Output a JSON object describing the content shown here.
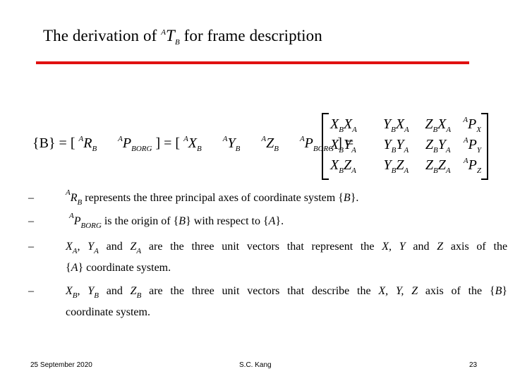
{
  "slide": {
    "title": {
      "prefix": "The derivation of ",
      "sup": "A",
      "symbol": "T",
      "sub": "B",
      "suffix": " for frame description"
    },
    "accent_color": "#e01010",
    "equation": {
      "lhs": "{B} = [",
      "r_sup": "A",
      "r_sym": "R",
      "r_sub": "B",
      "p_sup": "A",
      "p_sym": "P",
      "p_sub": "BORG",
      "mid": "] = [",
      "x_sup": "A",
      "x_sym": "X",
      "x_sub": "B",
      "y_sup": "A",
      "y_sym": "Y",
      "y_sub": "B",
      "z_sup": "A",
      "z_sym": "Z",
      "z_sub": "B",
      "p2_sup": "A",
      "p2_sym": "P",
      "p2_sub": "BORG",
      "end": "] ="
    },
    "matrix": {
      "rows": [
        [
          {
            "a": "X",
            "as": "B",
            "b": "X",
            "bs": "A"
          },
          {
            "a": "Y",
            "as": "B",
            "b": "X",
            "bs": "A"
          },
          {
            "a": "Z",
            "as": "B",
            "b": "X",
            "bs": "A"
          },
          {
            "sup": "A",
            "a": "P",
            "as": "X"
          }
        ],
        [
          {
            "a": "X",
            "as": "B",
            "b": "Y",
            "bs": "A"
          },
          {
            "a": "Y",
            "as": "B",
            "b": "Y",
            "bs": "A"
          },
          {
            "a": "Z",
            "as": "B",
            "b": "Y",
            "bs": "A"
          },
          {
            "sup": "A",
            "a": "P",
            "as": "Y"
          }
        ],
        [
          {
            "a": "X",
            "as": "B",
            "b": "Z",
            "bs": "A"
          },
          {
            "a": "Y",
            "as": "B",
            "b": "Z",
            "bs": "A"
          },
          {
            "a": "Z",
            "as": "B",
            "b": "Z",
            "bs": "A"
          },
          {
            "sup": "A",
            "a": "P",
            "as": "Z"
          }
        ]
      ]
    },
    "bullets": [
      {
        "dash": "–",
        "sup": "A",
        "sym": "R",
        "sub": "B",
        "text": " represents the three principal axes of coordinate system {",
        "it": "B",
        "end": "}."
      },
      {
        "dash": "–",
        "sup": "A",
        "sym": "P",
        "sub": "BORG",
        "text": " is the origin of {",
        "it1": "B",
        "text2": "} with respect to {",
        "it2": "A",
        "end": "}."
      },
      {
        "dash": "–",
        "v1": "X",
        "v1s": "A",
        "v2": "Y",
        "v2s": "A",
        "v3": "Z",
        "v3s": "A",
        "and": "and",
        "text": "are the three unit vectors that represent the",
        "ax": "X,",
        "ay": "Y",
        "and2": "and",
        "az": "Z",
        "text2": "axis of the",
        "line2_open": "{",
        "line2_it": "A",
        "line2_rest": "} coordinate system."
      },
      {
        "dash": "–",
        "v1": "X",
        "v1s": "B",
        "v2": "Y",
        "v2s": "B",
        "v3": "Z",
        "v3s": "B",
        "and": "and",
        "text": "are the three unit vectors that describe the",
        "ax": "X,",
        "ay": "Y,",
        "az": "Z",
        "text2": "axis of the {",
        "it": "B",
        "end": "}",
        "line2": "coordinate system."
      }
    ],
    "footer": {
      "date": "25 September 2020",
      "author": "S.C. Kang",
      "page": "23"
    }
  }
}
